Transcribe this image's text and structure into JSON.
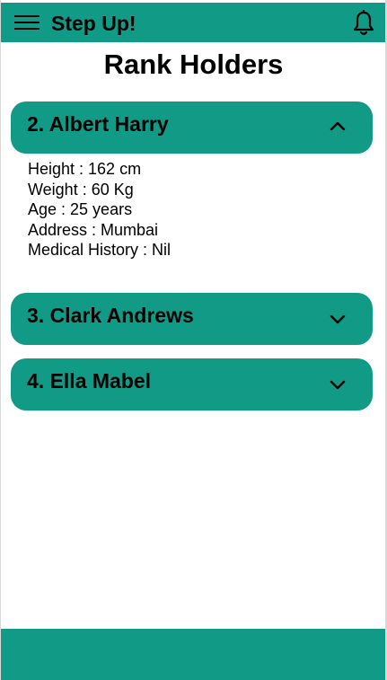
{
  "app": {
    "title": "Step Up!",
    "brand_color": "#119a85",
    "menu_icon": "hamburger-menu-icon",
    "notification_icon": "bell-icon"
  },
  "page": {
    "title": "Rank Holders"
  },
  "accordion": [
    {
      "name": "2. Albert Harry",
      "expanded": true,
      "details": [
        "Height : 162 cm",
        "Weight : 60 Kg",
        "Age : 25 years",
        "Address : Mumbai",
        "Medical History : Nil"
      ]
    },
    {
      "name": "3. Clark Andrews",
      "expanded": false
    },
    {
      "name": "4. Ella Mabel",
      "expanded": false
    }
  ]
}
